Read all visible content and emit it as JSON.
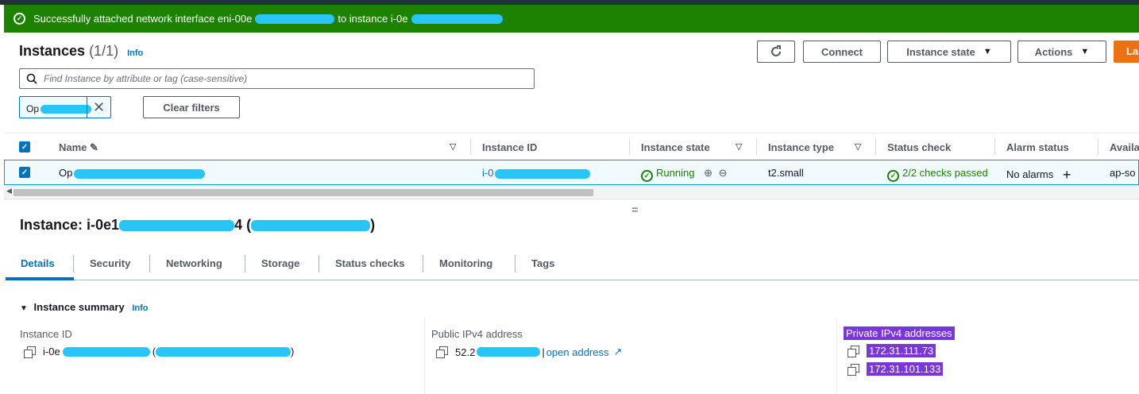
{
  "flash": {
    "prefix": "Successfully attached network interface eni-00e",
    "middle": "to instance i-0e"
  },
  "instances": {
    "title": "Instances",
    "count": "(1/1)",
    "info": "Info",
    "buttons": {
      "connect": "Connect",
      "instance_state": "Instance state",
      "actions": "Actions",
      "launch": "La"
    },
    "search_placeholder": "Find Instance by attribute or tag (case-sensitive)",
    "filter_token": "Op",
    "clear_filters": "Clear filters"
  },
  "table": {
    "headers": {
      "name": "Name",
      "instance_id": "Instance ID",
      "instance_state": "Instance state",
      "instance_type": "Instance type",
      "status_check": "Status check",
      "alarm_status": "Alarm status",
      "availability": "Availa"
    },
    "row": {
      "name": "Op",
      "instance_id": "i-0",
      "state": "Running",
      "type": "t2.small",
      "status": "2/2 checks passed",
      "alarm": "No alarms",
      "az": "ap-so"
    }
  },
  "details": {
    "title_prefix": "Instance: i-0e1",
    "title_suffix": "4 (",
    "title_end": ")",
    "tabs": [
      "Details",
      "Security",
      "Networking",
      "Storage",
      "Status checks",
      "Monitoring",
      "Tags"
    ],
    "summary_label": "Instance summary",
    "summary_info": "Info",
    "instance_id_label": "Instance ID",
    "instance_id_value": "i-0e",
    "instance_id_paren": "(",
    "instance_id_end": ")",
    "public_ip_label": "Public IPv4 address",
    "public_ip_value": "52.2",
    "open_address": "open address",
    "private_ip_label": "Private IPv4 addresses",
    "private_ips": [
      "172.31.111.73",
      "172.31.101.133"
    ]
  }
}
